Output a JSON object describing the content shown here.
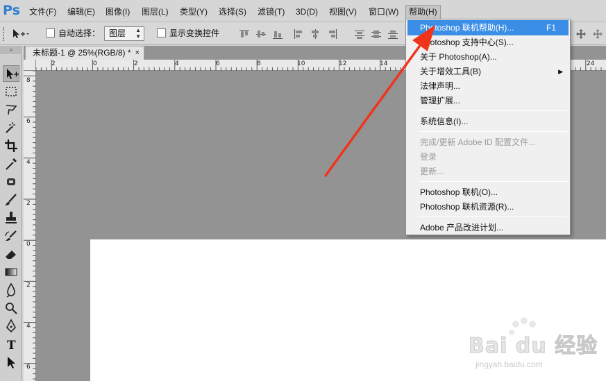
{
  "app": {
    "logo": "Ps",
    "menus": [
      "文件(F)",
      "编辑(E)",
      "图像(I)",
      "图层(L)",
      "类型(Y)",
      "选择(S)",
      "滤镜(T)",
      "3D(D)",
      "视图(V)",
      "窗口(W)",
      "帮助(H)"
    ],
    "active_menu": "帮助(H)"
  },
  "options": {
    "auto_select_label": "自动选择：",
    "auto_select_target": "图层",
    "show_transform_label": "显示变换控件"
  },
  "document": {
    "tab_title": "未标题-1 @ 25%(RGB/8) *",
    "close_glyph": "×",
    "ruler_h_labels": [
      "2",
      "0",
      "2",
      "4",
      "6",
      "8",
      "10",
      "12",
      "14",
      "24"
    ],
    "ruler_v_labels": [
      "8",
      "6",
      "4",
      "2",
      "0",
      "2",
      "4",
      "6"
    ]
  },
  "help_menu": {
    "items": [
      {
        "label": "Photoshop 联机帮助(H)...",
        "shortcut": "F1",
        "state": "highlighted"
      },
      {
        "label": "Photoshop 支持中心(S)...",
        "state": "normal"
      },
      {
        "label": "关于 Photoshop(A)...",
        "state": "normal"
      },
      {
        "label": "关于增效工具(B)",
        "state": "normal",
        "submenu": true
      },
      {
        "label": "法律声明...",
        "state": "normal"
      },
      {
        "label": "管理扩展...",
        "state": "normal"
      },
      {
        "label": "系统信息(I)...",
        "state": "normal"
      },
      {
        "label": "完成/更新 Adobe ID 配置文件...",
        "state": "disabled"
      },
      {
        "label": "登录",
        "state": "disabled"
      },
      {
        "label": "更新...",
        "state": "disabled"
      },
      {
        "label": "Photoshop 联机(O)...",
        "state": "normal"
      },
      {
        "label": "Photoshop 联机资源(R)...",
        "state": "normal"
      },
      {
        "label": "Adobe 产品改进计划...",
        "state": "normal"
      }
    ]
  },
  "watermark": {
    "main": "Bai du 经验",
    "sub": "jingyan.baidu.com"
  },
  "colors": {
    "highlight": "#3a8ee6",
    "arrow": "#f0341c",
    "ps_blue": "#2d7dd2"
  }
}
